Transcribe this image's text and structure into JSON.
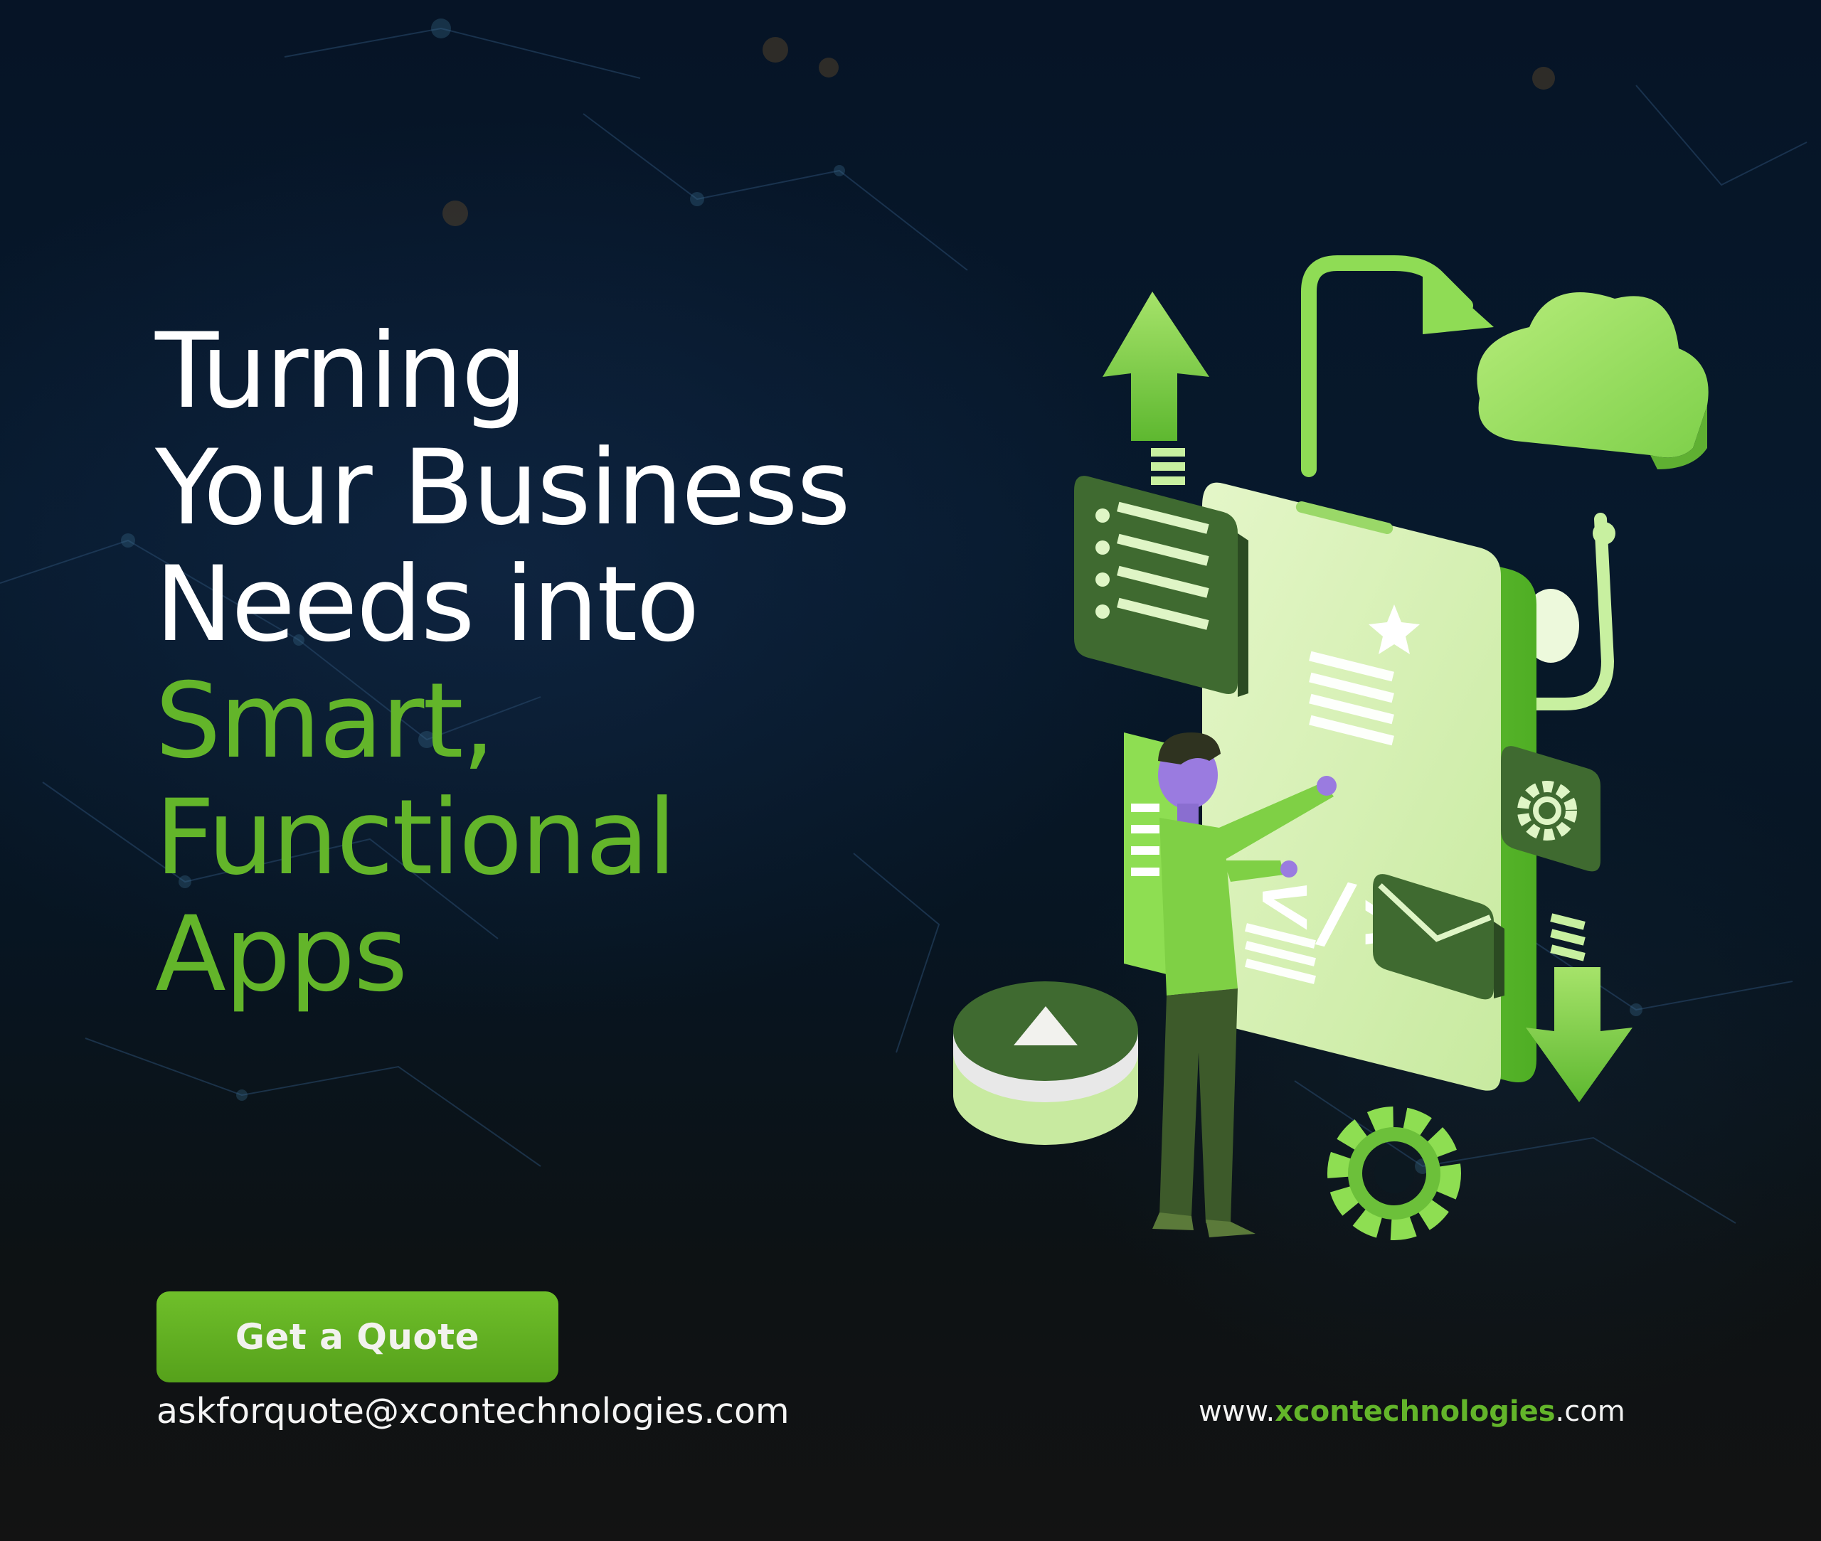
{
  "headline": {
    "line1": "Turning",
    "line2": "Your Business",
    "line3": "Needs into",
    "line4": "Smart,",
    "line5": "Functional",
    "line6": "Apps"
  },
  "cta": {
    "label": "Get a Quote"
  },
  "contact": {
    "email": "askforquote@xcontechnologies.com",
    "website_prefix": "www.",
    "website_brand": "xcontechnologies",
    "website_suffix": ".com"
  },
  "illustration": {
    "code_symbol": "</>"
  },
  "colors": {
    "accent_green": "#63b52a",
    "button_green": "#5fae22",
    "background": "#061426",
    "text_white": "#ffffff"
  },
  "icons": [
    "upload-arrow-icon",
    "cloud-icon",
    "gear-icon",
    "envelope-icon",
    "download-arrow-icon",
    "play-button-icon",
    "list-panel-icon",
    "star-icon"
  ]
}
